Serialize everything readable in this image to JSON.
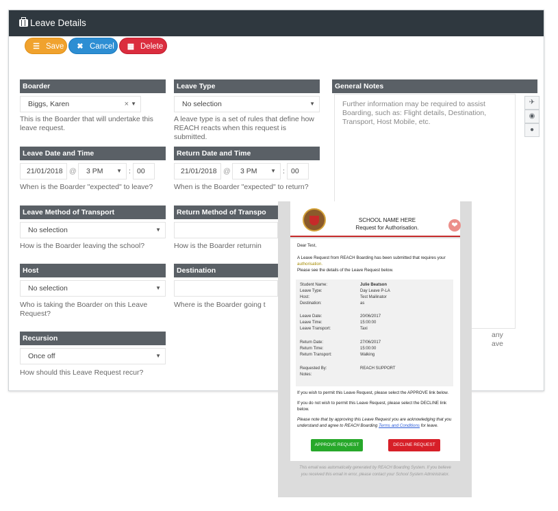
{
  "panel": {
    "title": "Leave Details"
  },
  "toolbar": {
    "save_label": "Save",
    "cancel_label": "Cancel",
    "delete_label": "Delete"
  },
  "boarder": {
    "label": "Boarder",
    "value": "Biggs, Karen",
    "help": [
      "This is the Boarder that will undertake this",
      "leave request."
    ]
  },
  "leave_type": {
    "label": "Leave Type",
    "value": "No selection",
    "help": [
      "A leave type is a set of rules that define how",
      "REACH reacts when this request is submitted."
    ]
  },
  "general_notes": {
    "label": "General Notes",
    "placeholder": [
      "Further information may be required to assist",
      "Boarding, such as: Flight details, Destination,",
      "Transport, Host Mobile, etc."
    ],
    "clipped_1": "any",
    "clipped_2": "ave"
  },
  "leave_date": {
    "label": "Leave Date and Time",
    "date": "21/01/2018",
    "at": "@",
    "hour": "3 PM",
    "sep": ":",
    "minute": "00",
    "help": "When is the Boarder \"expected\" to leave?"
  },
  "return_date": {
    "label": "Return Date and Time",
    "date": "21/01/2018",
    "at": "@",
    "hour": "3 PM",
    "sep": ":",
    "minute": "00",
    "help": "When is the Boarder \"expected\" to return?"
  },
  "leave_transport": {
    "label": "Leave Method of Transport",
    "value": "No selection",
    "help": "How is the Boarder leaving the school?"
  },
  "return_transport": {
    "label": "Return Method of Transpo",
    "help": "How is the Boarder returnin"
  },
  "host": {
    "label": "Host",
    "value": "No selection",
    "help": [
      "Who is taking the Boarder on this Leave",
      "Request?"
    ]
  },
  "destination": {
    "label": "Destination",
    "help": "Where is the Boarder going t"
  },
  "recursion": {
    "label": "Recursion",
    "value": "Once off",
    "help": "How should this Leave Request recur?"
  },
  "side_icons": [
    "plane-icon",
    "car-icon",
    "person-icon"
  ],
  "email": {
    "school": "SCHOOL NAME HERE",
    "subtitle": "Request for Authorisation.",
    "greeting": "Dear Test,",
    "intro_1": "A Leave Request from REACH Boarding has been submitted that requires your",
    "intro_2": "authorisation.",
    "intro_3": "Please see the details of the Leave Request below.",
    "details": [
      {
        "k": "Student Name:",
        "v": "Julie Beatson",
        "bold": true
      },
      {
        "k": "Leave Type:",
        "v": "Day Leave P-LA"
      },
      {
        "k": "Host:",
        "v": "Test Mailinator"
      },
      {
        "k": "Destination:",
        "v": "as"
      },
      {
        "k": "Leave Date:",
        "v": "20/06/2017"
      },
      {
        "k": "Leave Time:",
        "v": "15:00:00"
      },
      {
        "k": "Leave Transport:",
        "v": "Taxi"
      },
      {
        "k": "Return Date:",
        "v": "27/06/2017"
      },
      {
        "k": "Return Time:",
        "v": "15:00:00"
      },
      {
        "k": "Return Transport:",
        "v": "Walking"
      },
      {
        "k": "Requested By:",
        "v": "REACH SUPPORT"
      },
      {
        "k": "Notes:",
        "v": ""
      }
    ],
    "permit": "If you wish to permit this Leave Request, please select the APPROVE link below.",
    "decline_1": "If you do not wish to permit this Leave Request, please select the DECLINE link",
    "decline_2": "below.",
    "terms_1": "Please note that by approving this Leave Request you are acknowledging that you",
    "terms_2a": "understand and agree to REACH Boarding ",
    "terms_link": "Terms and Conditions",
    "terms_2b": " for leave.",
    "approve": "APPROVE REQUEST",
    "decline": "DECLINE REQUEST",
    "footer_1": "This email was automatically generated by REACH Boarding System. If you believe",
    "footer_2": "you received this email in error, please contact your School System Administrator."
  },
  "colors": {
    "header": "#2f383f",
    "label_bg": "#5a6066",
    "save": "#f0a22e",
    "cancel": "#2d8ed3",
    "delete": "#db2d3e",
    "approve": "#27a82a",
    "decline": "#d71f28"
  }
}
